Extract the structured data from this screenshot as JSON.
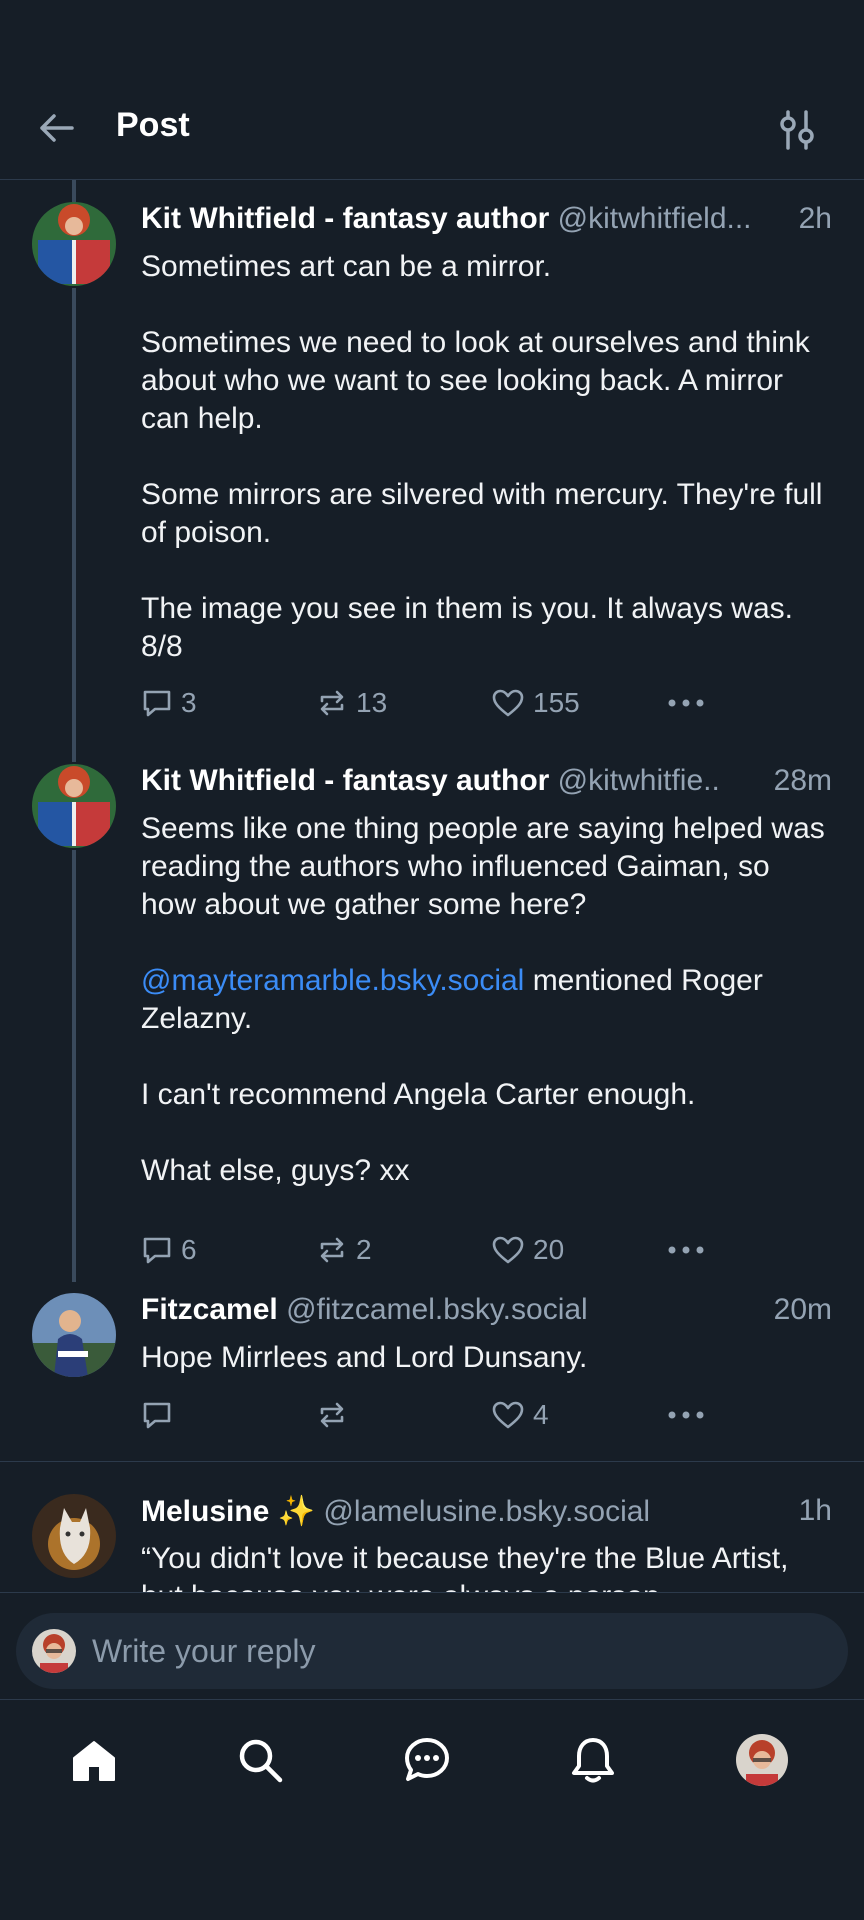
{
  "header": {
    "title": "Post"
  },
  "posts": [
    {
      "author": "Kit Whitfield - fantasy author",
      "handle": "@kitwhitfield...",
      "time": "2h",
      "paragraphs": [
        "Sometimes art can be a mirror.",
        "Sometimes we need to look at ourselves and think about who we want to see looking back. A mirror can help.",
        "Some mirrors are silvered with mercury. They're full of poison.",
        "The image you see in them is you. It always was. 8/8"
      ],
      "replies": "3",
      "reposts": "13",
      "likes": "155"
    },
    {
      "author": "Kit Whitfield - fantasy author",
      "handle": "@kitwhitfie..",
      "time": "28m",
      "p1": "Seems like one thing people are saying helped was reading the authors who influenced Gaiman, so how about we gather some here?",
      "mention": "@mayteramarble.bsky.social",
      "p2_rest": " mentioned Roger Zelazny.",
      "p3": "I can't recommend Angela Carter enough.",
      "p4": "What else, guys? xx",
      "replies": "6",
      "reposts": "2",
      "likes": "20"
    },
    {
      "author": "Fitzcamel",
      "handle": "@fitzcamel.bsky.social",
      "time": "20m",
      "text": "Hope Mirrlees and Lord Dunsany.",
      "replies": "",
      "reposts": "",
      "likes": "4"
    },
    {
      "author": "Melusine ✨",
      "handle": "@lamelusine.bsky.social",
      "time": "1h",
      "text": "“You didn't love it because they're the Blue Artist, but because you were always a person"
    }
  ],
  "reply_bar": {
    "placeholder": "Write your reply"
  },
  "nav": [
    "home-icon",
    "search-icon",
    "chat-icon",
    "bell-icon",
    "profile-avatar"
  ],
  "colors": {
    "background": "#161e27",
    "accent": "#3b8cf6",
    "muted": "#94a3b3",
    "divider": "#2c3a4b"
  }
}
